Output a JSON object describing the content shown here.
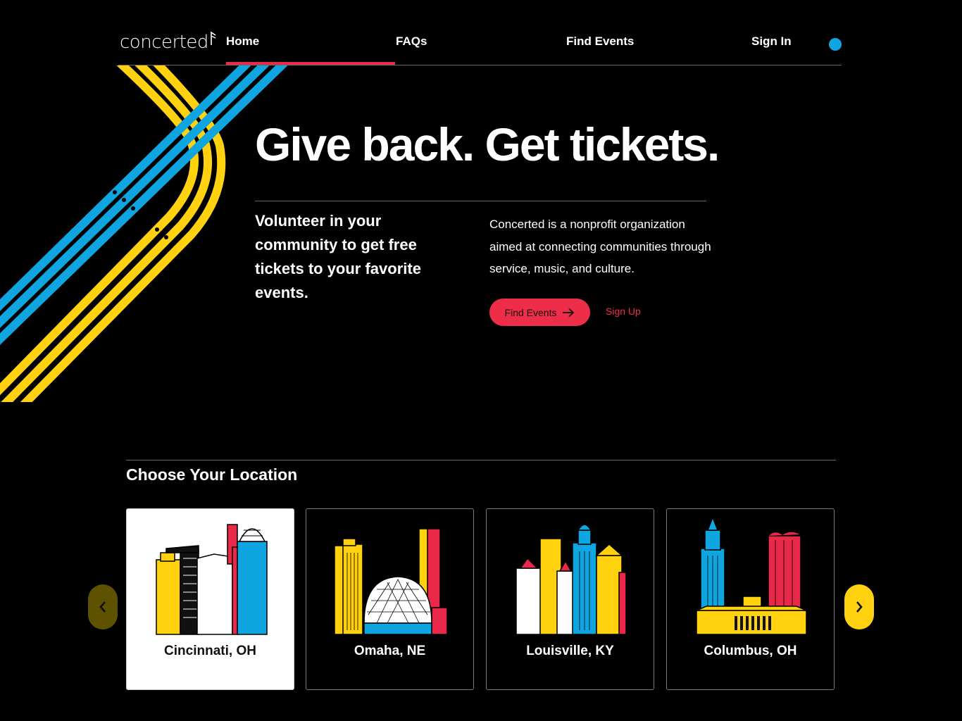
{
  "header": {
    "logo_text": "concerted",
    "nav": [
      {
        "label": "Home"
      },
      {
        "label": "FAQs"
      },
      {
        "label": "Find Events"
      },
      {
        "label": "Sign In"
      }
    ]
  },
  "hero": {
    "title": "Give back. Get tickets.",
    "tagline": "Volunteer in your community to get free tickets to your favorite events.",
    "description": "Concerted is a nonprofit organization aimed at connecting communities through service, music, and culture.",
    "primary_button": "Find Events",
    "secondary_button": "Sign Up"
  },
  "locations": {
    "heading": "Choose Your Location",
    "cards": [
      {
        "label": "Cincinnati, OH",
        "selected": true
      },
      {
        "label": "Omaha, NE",
        "selected": false
      },
      {
        "label": "Louisville, KY",
        "selected": false
      },
      {
        "label": "Columbus, OH",
        "selected": false
      }
    ]
  },
  "colors": {
    "accent_red": "#ee2d49",
    "brand_blue": "#0ea5e0",
    "brand_yellow": "#ffd10f",
    "background": "#000000"
  },
  "icons": {
    "arrow_right": "arrow-right-icon",
    "prev": "chevron-left-icon",
    "next": "chevron-right-icon"
  }
}
